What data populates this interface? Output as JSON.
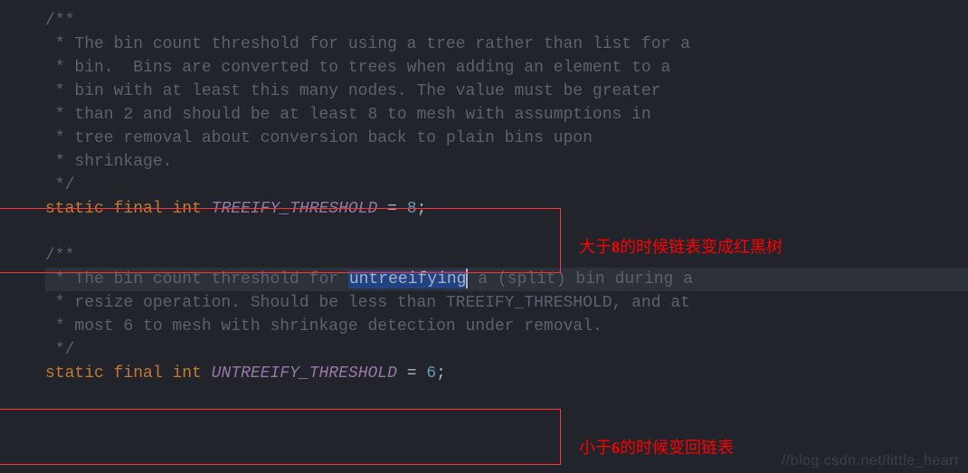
{
  "code": {
    "kw": {
      "static": "static",
      "final": "final",
      "int": "int"
    },
    "op": {
      "eq": "=",
      "semi": ";"
    },
    "block1": {
      "l0": "/**",
      "l1": " * The bin count threshold for using a tree rather than list for a",
      "l2": " * bin.  Bins are converted to trees when adding an element to a",
      "l3": " * bin with at least this many nodes. The value must be greater",
      "l4": " * than 2 and should be at least 8 to mesh with assumptions in",
      "l5": " * tree removal about conversion back to plain bins upon",
      "l6": " * shrinkage.",
      "l7": " */"
    },
    "decl1": {
      "name": "TREEIFY_THRESHOLD",
      "value": "8"
    },
    "block2": {
      "l0": "/**",
      "pre": " * The bin count threshold for ",
      "sel": "untreeifying",
      "post": " a (split) bin during a",
      "l2": " * resize operation. Should be less than TREEIFY_THRESHOLD, and at",
      "l3": " * most 6 to mesh with shrinkage detection under removal.",
      "l4": " */"
    },
    "decl2": {
      "name": "UNTREEIFY_THRESHOLD",
      "value": "6"
    }
  },
  "boxes": [
    {
      "style": "left:-12px;top:230px;width:630px;height:70px;"
    },
    {
      "style": "left:-12px;top:452px;width:630px;height:60px;"
    }
  ],
  "notes": [
    {
      "pre": "大于",
      "bold": "8",
      "post": "的时候链表变成红黑树"
    },
    {
      "pre": "小于",
      "bold": "6",
      "post": "的时候变回链表"
    }
  ],
  "watermark": "//blog.csdn.net/little_heart"
}
